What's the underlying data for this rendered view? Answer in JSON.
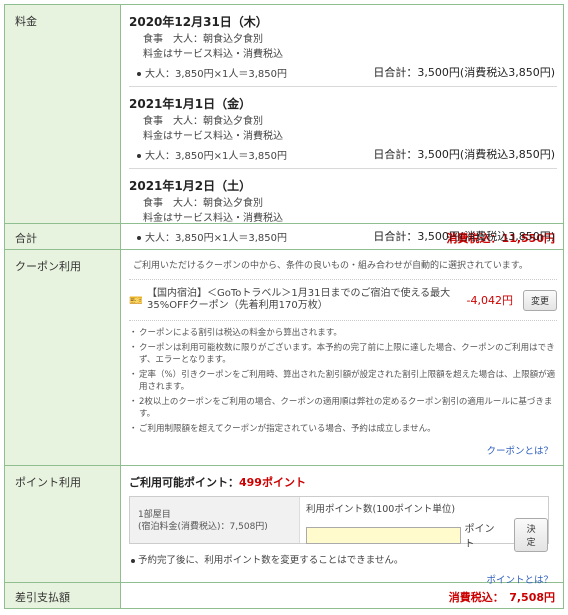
{
  "labels": {
    "fee": "料金",
    "total": "合計",
    "coupon": "クーポン利用",
    "points": "ポイント利用",
    "payment": "差引支払額"
  },
  "days": [
    {
      "date": "2020年12月31日（木）",
      "meal": "食事　大人：朝食込夕食別",
      "tax_note": "料金はサービス料込・消費税込",
      "breakdown": "大人：3,850円×1人＝3,850円",
      "subtotal": "日合計：3,500円(消費税込3,850円)"
    },
    {
      "date": "2021年1月1日（金）",
      "meal": "食事　大人：朝食込夕食別",
      "tax_note": "料金はサービス料込・消費税込",
      "breakdown": "大人：3,850円×1人＝3,850円",
      "subtotal": "日合計：3,500円(消費税込3,850円)"
    },
    {
      "date": "2021年1月2日（土）",
      "meal": "食事　大人：朝食込夕食別",
      "tax_note": "料金はサービス料込・消費税込",
      "breakdown": "大人：3,850円×1人＝3,850円",
      "subtotal": "日合計：3,500円(消費税込3,850円)"
    }
  ],
  "total": "消費税込：11,550円",
  "coupon": {
    "intro": "ご利用いただけるクーポンの中から、条件の良いもの・組み合わせが自動的に選択されています。",
    "item_name": "【国内宿泊】＜GoToトラベル＞1月31日までのご宿泊で使える最大35%OFFクーポン（先着利用170万枚）",
    "item_amount": "-4,042円",
    "change_button": "変更",
    "notes": [
      "クーポンによる割引は税込の料金から算出されます。",
      "クーポンは利用可能枚数に限りがございます。本予約の完了前に上限に達した場合、クーポンのご利用はできず、エラーとなります。",
      "定率（%）引きクーポンをご利用時、算出された割引額が設定された割引上限額を超えた場合は、上限額が適用されます。",
      "2枚以上のクーポンをご利用の場合、クーポンの適用順は弊社の定めるクーポン割引の適用ルールに基づきます。",
      "ご利用制限額を超えてクーポンが指定されている場合、予約は成立しません。"
    ],
    "link": "クーポンとは？"
  },
  "points": {
    "available_label": "ご利用可能ポイント：",
    "available_value": "499ポイント",
    "room_label": "1部屋目",
    "room_fee": "(宿泊料金(消費税込)：7,508円)",
    "input_label": "利用ポイント数(100ポイント単位)",
    "input_value": "",
    "unit": "ポイント",
    "decide_button": "決定",
    "note": "予約完了後に、利用ポイント数を変更することはできません。",
    "link": "ポイントとは？"
  },
  "payment": "消費税込：　7,508円",
  "colors": {
    "label_bg": "#e8f3df",
    "border": "#8fbf8f",
    "accent_red": "#cc0000",
    "link_blue": "#2f5fbf",
    "input_bg": "#fffbcc"
  }
}
